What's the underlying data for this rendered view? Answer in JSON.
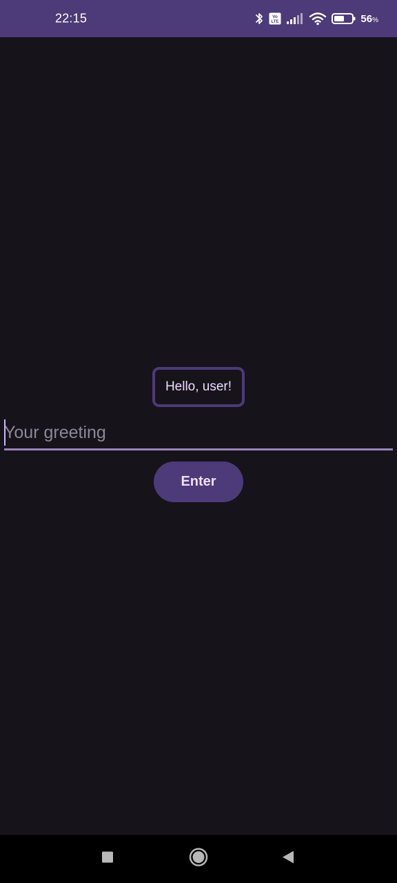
{
  "status_bar": {
    "time": "22:15",
    "battery_percent": "56",
    "battery_unit": "%",
    "battery_level": 0.56,
    "network_label": "Vo LTE",
    "icons": [
      "bluetooth-icon",
      "volte-icon",
      "signal-icon",
      "wifi-icon",
      "battery-icon"
    ],
    "background_color": "#4d3a78"
  },
  "main": {
    "greeting_text": "Hello, user!",
    "input": {
      "value": "",
      "placeholder": "Your greeting"
    },
    "enter_button_label": "Enter",
    "accent_color": "#4d3a78",
    "background_color": "#16131b"
  },
  "nav_bar": {
    "buttons": [
      "recents-button",
      "home-button",
      "back-button"
    ]
  }
}
